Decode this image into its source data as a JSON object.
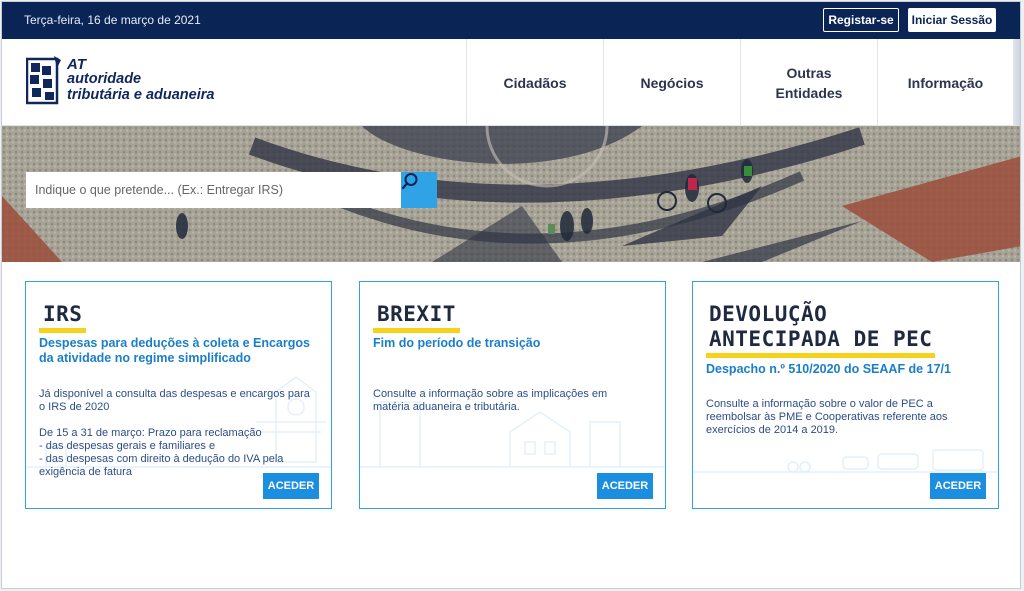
{
  "topbar": {
    "date": "Terça-feira, 16 de março de 2021",
    "register_label": "Registar-se",
    "login_label": "Iniciar Sessão"
  },
  "logo": {
    "line1": "AT",
    "line2": "autoridade",
    "line3": "tributária e aduaneira"
  },
  "nav": {
    "items": [
      {
        "label": "Cidadãos"
      },
      {
        "label": "Negócios"
      },
      {
        "label": "Outras Entidades"
      },
      {
        "label": "Informação"
      }
    ]
  },
  "search": {
    "placeholder": "Indique o que pretende... (Ex.: Entregar IRS)",
    "value": "",
    "icon": "search-icon"
  },
  "cards": [
    {
      "title": "IRS",
      "subtitle": "Despesas para deduções à coleta e Encargos da atividade no regime simplificado",
      "body": [
        "Já disponível a consulta das despesas e encargos para o IRS de 2020",
        "De 15 a 31 de março: Prazo para reclamação\n- das despesas gerais e familiares e\n- das despesas com direito à dedução do IVA pela exigência de fatura"
      ],
      "button": "ACEDER"
    },
    {
      "title": "BREXIT",
      "subtitle": "Fim do período de transição",
      "body": [
        "Consulte a informação sobre as implicações em matéria aduaneira e tributária."
      ],
      "button": "ACEDER"
    },
    {
      "title_line1": "DEVOLUÇÃO",
      "title_line2": "ANTECIPADA DE PEC",
      "subtitle": "Despacho n.º 510/2020 do SEAAF de 17/1",
      "body": [
        "Consulte a informação sobre o valor de PEC a reembolsar às PME e Cooperativas referente aos exercícios de 2014 a 2019."
      ],
      "button": "ACEDER"
    }
  ],
  "colors": {
    "topbar": "#0a2456",
    "accent": "#2fa3e6",
    "button": "#1c8ee0",
    "underline": "#f7d21b",
    "subtitle": "#1a7fc8"
  }
}
